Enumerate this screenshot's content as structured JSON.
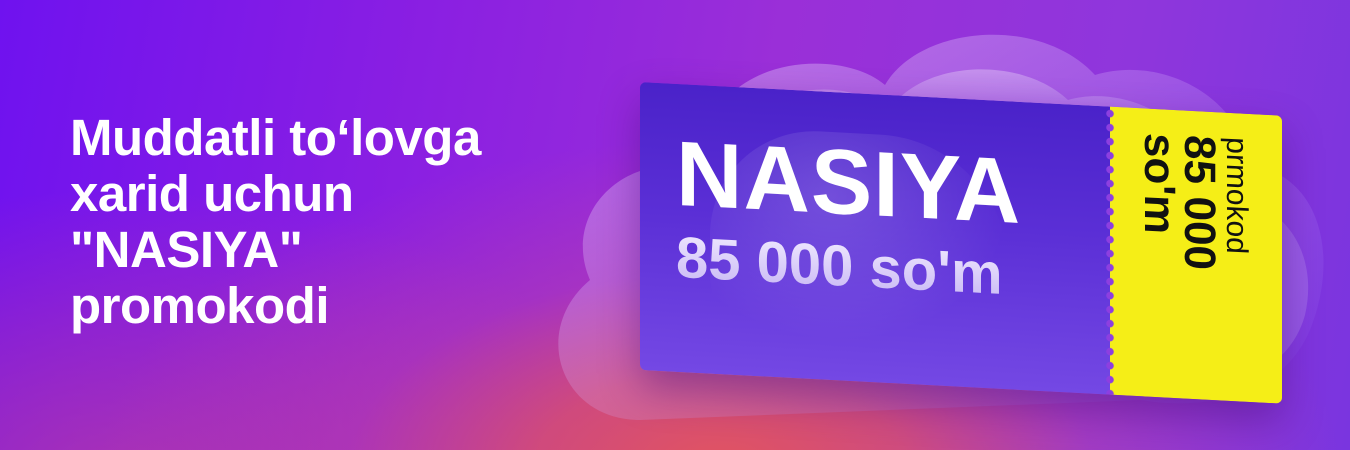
{
  "headline": {
    "line1": "Muddatli to‘lovga",
    "line2": "xarid uchun",
    "line3": "\"NASIYA\"",
    "line4": "promokodi"
  },
  "ticket": {
    "title": "NASIYA",
    "amount": "85 000 so'm",
    "stub_label": "prmokod",
    "stub_amount": "85 000",
    "stub_currency": "so'm"
  },
  "colors": {
    "background_primary": "#7a1cf0",
    "background_glow": "#e2545f",
    "ticket_main": "#5b2fd6",
    "ticket_stub": "#f5ee17",
    "headline_text": "#ffffff",
    "stub_text": "#111111"
  }
}
